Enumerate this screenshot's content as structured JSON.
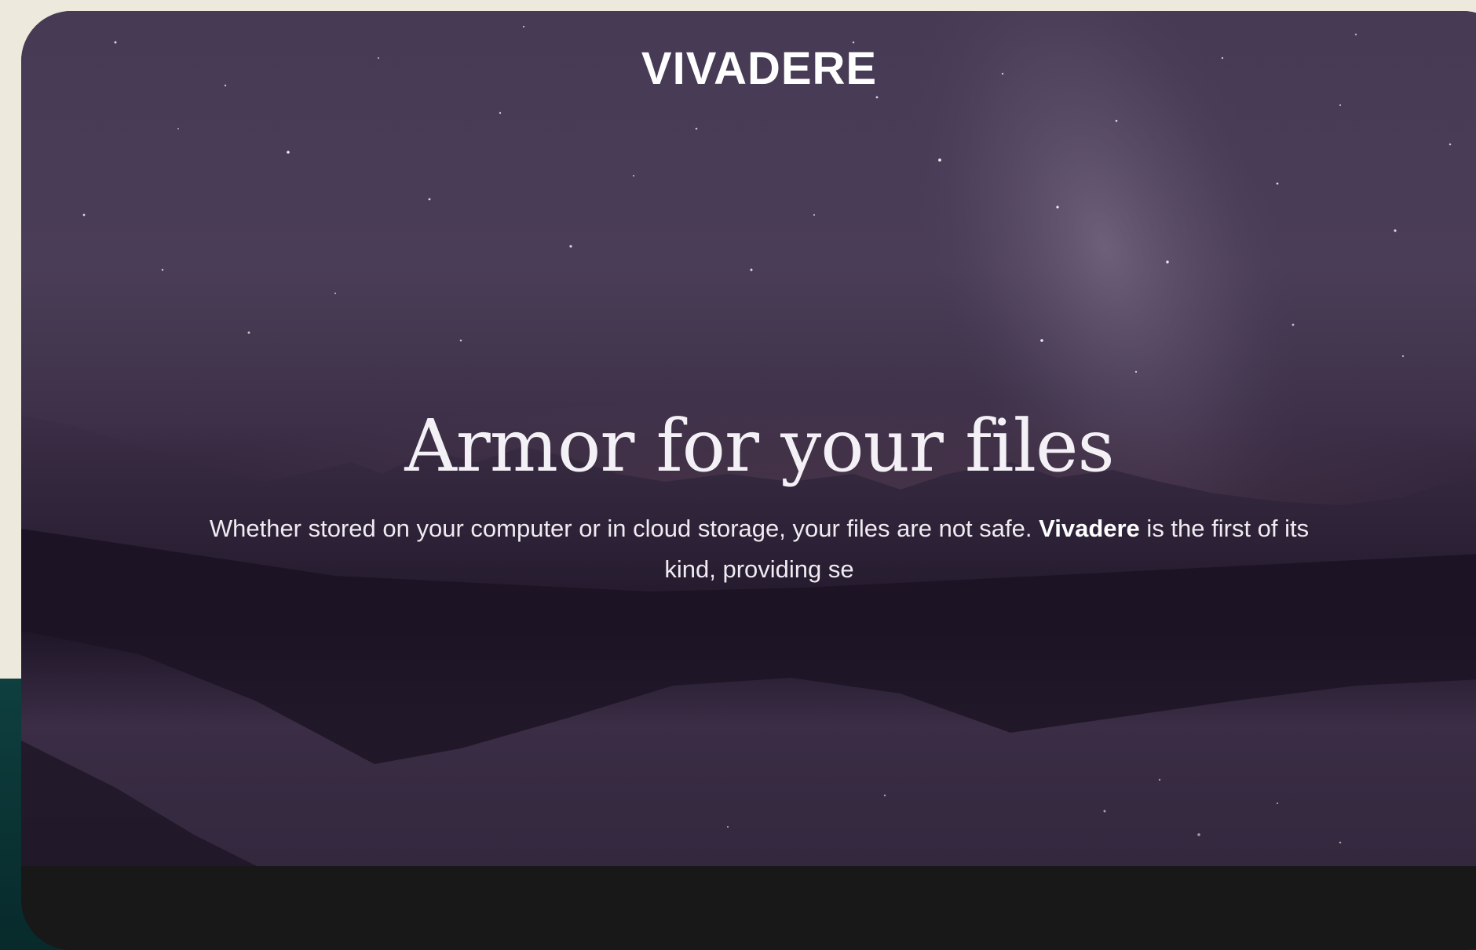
{
  "brand": {
    "name": "VIVADERE"
  },
  "hero": {
    "headline": "Armor for your files",
    "tagline_part1": "Whether stored on your computer or in cloud storage, your files are not safe. ",
    "tagline_brand": "Vivadere",
    "tagline_part2": " is the first of its kind, providing se"
  },
  "colors": {
    "page_background": "#ede9dd",
    "hero_sky": "#463a54",
    "hero_ground": "#1f1628",
    "footer": "#181818",
    "side_teal": "#0f3f3f",
    "text": "#ffffff"
  }
}
